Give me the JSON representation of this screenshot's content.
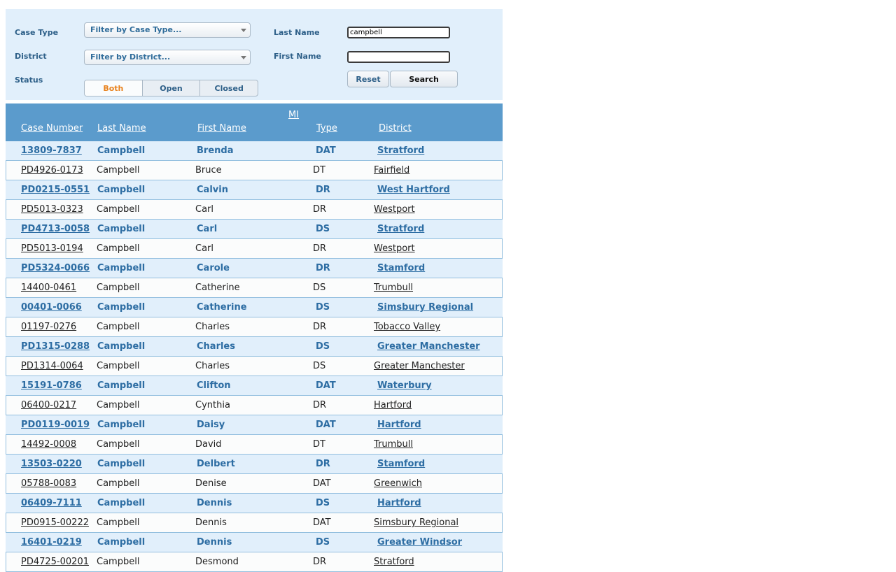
{
  "filters": {
    "case_type_label": "Case Type",
    "district_label": "District",
    "status_label": "Status",
    "last_name_label": "Last Name",
    "first_name_label": "First Name",
    "case_type_placeholder": "Filter by Case Type...",
    "district_placeholder": "Filter by District...",
    "last_name_value": "campbell",
    "first_name_value": "",
    "status_options": [
      "Both",
      "Open",
      "Closed"
    ],
    "status_selected": "Both",
    "reset_label": "Reset",
    "search_label": "Search"
  },
  "table": {
    "columns": {
      "case_number": "Case Number",
      "last_name": "Last Name",
      "first_name": "First Name",
      "mi": "MI",
      "type": "Type",
      "district": "District"
    },
    "rows": [
      {
        "case": "13809-7837",
        "last": "Campbell",
        "first": "Brenda",
        "type": "DAT",
        "district": "Stratford"
      },
      {
        "case": "PD4926-0173",
        "last": "Campbell",
        "first": "Bruce",
        "type": "DT",
        "district": "Fairfield"
      },
      {
        "case": "PD0215-0551",
        "last": "Campbell",
        "first": "Calvin",
        "type": "DR",
        "district": "West Hartford"
      },
      {
        "case": "PD5013-0323",
        "last": "Campbell",
        "first": "Carl",
        "type": "DR",
        "district": "Westport"
      },
      {
        "case": "PD4713-0058",
        "last": "Campbell",
        "first": "Carl",
        "type": "DS",
        "district": "Stratford"
      },
      {
        "case": "PD5013-0194",
        "last": "Campbell",
        "first": "Carl",
        "type": "DR",
        "district": "Westport"
      },
      {
        "case": "PD5324-0066",
        "last": "Campbell",
        "first": "Carole",
        "type": "DR",
        "district": "Stamford"
      },
      {
        "case": "14400-0461",
        "last": "Campbell",
        "first": "Catherine",
        "type": "DS",
        "district": "Trumbull"
      },
      {
        "case": "00401-0066",
        "last": "Campbell",
        "first": "Catherine",
        "type": "DS",
        "district": "Simsbury Regional"
      },
      {
        "case": "01197-0276",
        "last": "Campbell",
        "first": "Charles",
        "type": "DR",
        "district": "Tobacco Valley"
      },
      {
        "case": "PD1315-0288",
        "last": "Campbell",
        "first": "Charles",
        "type": "DS",
        "district": "Greater Manchester"
      },
      {
        "case": "PD1314-0064",
        "last": "Campbell",
        "first": "Charles",
        "type": "DS",
        "district": "Greater Manchester"
      },
      {
        "case": "15191-0786",
        "last": "Campbell",
        "first": "Clifton",
        "type": "DAT",
        "district": "Waterbury"
      },
      {
        "case": "06400-0217",
        "last": "Campbell",
        "first": "Cynthia",
        "type": "DR",
        "district": "Hartford"
      },
      {
        "case": "PD0119-0019",
        "last": "Campbell",
        "first": "Daisy",
        "type": "DAT",
        "district": "Hartford"
      },
      {
        "case": "14492-0008",
        "last": "Campbell",
        "first": "David",
        "type": "DT",
        "district": "Trumbull"
      },
      {
        "case": "13503-0220",
        "last": "Campbell",
        "first": "Delbert",
        "type": "DR",
        "district": "Stamford"
      },
      {
        "case": "05788-0083",
        "last": "Campbell",
        "first": "Denise",
        "type": "DAT",
        "district": "Greenwich"
      },
      {
        "case": "06409-7111",
        "last": "Campbell",
        "first": "Dennis",
        "type": "DS",
        "district": "Hartford"
      },
      {
        "case": "PD0915-00222",
        "last": "Campbell",
        "first": "Dennis",
        "type": "DAT",
        "district": "Simsbury Regional"
      },
      {
        "case": "16401-0219",
        "last": "Campbell",
        "first": "Dennis",
        "type": "DS",
        "district": "Greater Windsor"
      },
      {
        "case": "PD4725-00201",
        "last": "Campbell",
        "first": "Desmond",
        "type": "DR",
        "district": "Stratford"
      }
    ]
  },
  "colors": {
    "panel_bg": "#e1effb",
    "header_bg": "#5b9bcc",
    "accent_text": "#2d6da3",
    "selected_segment": "#e8821e"
  }
}
